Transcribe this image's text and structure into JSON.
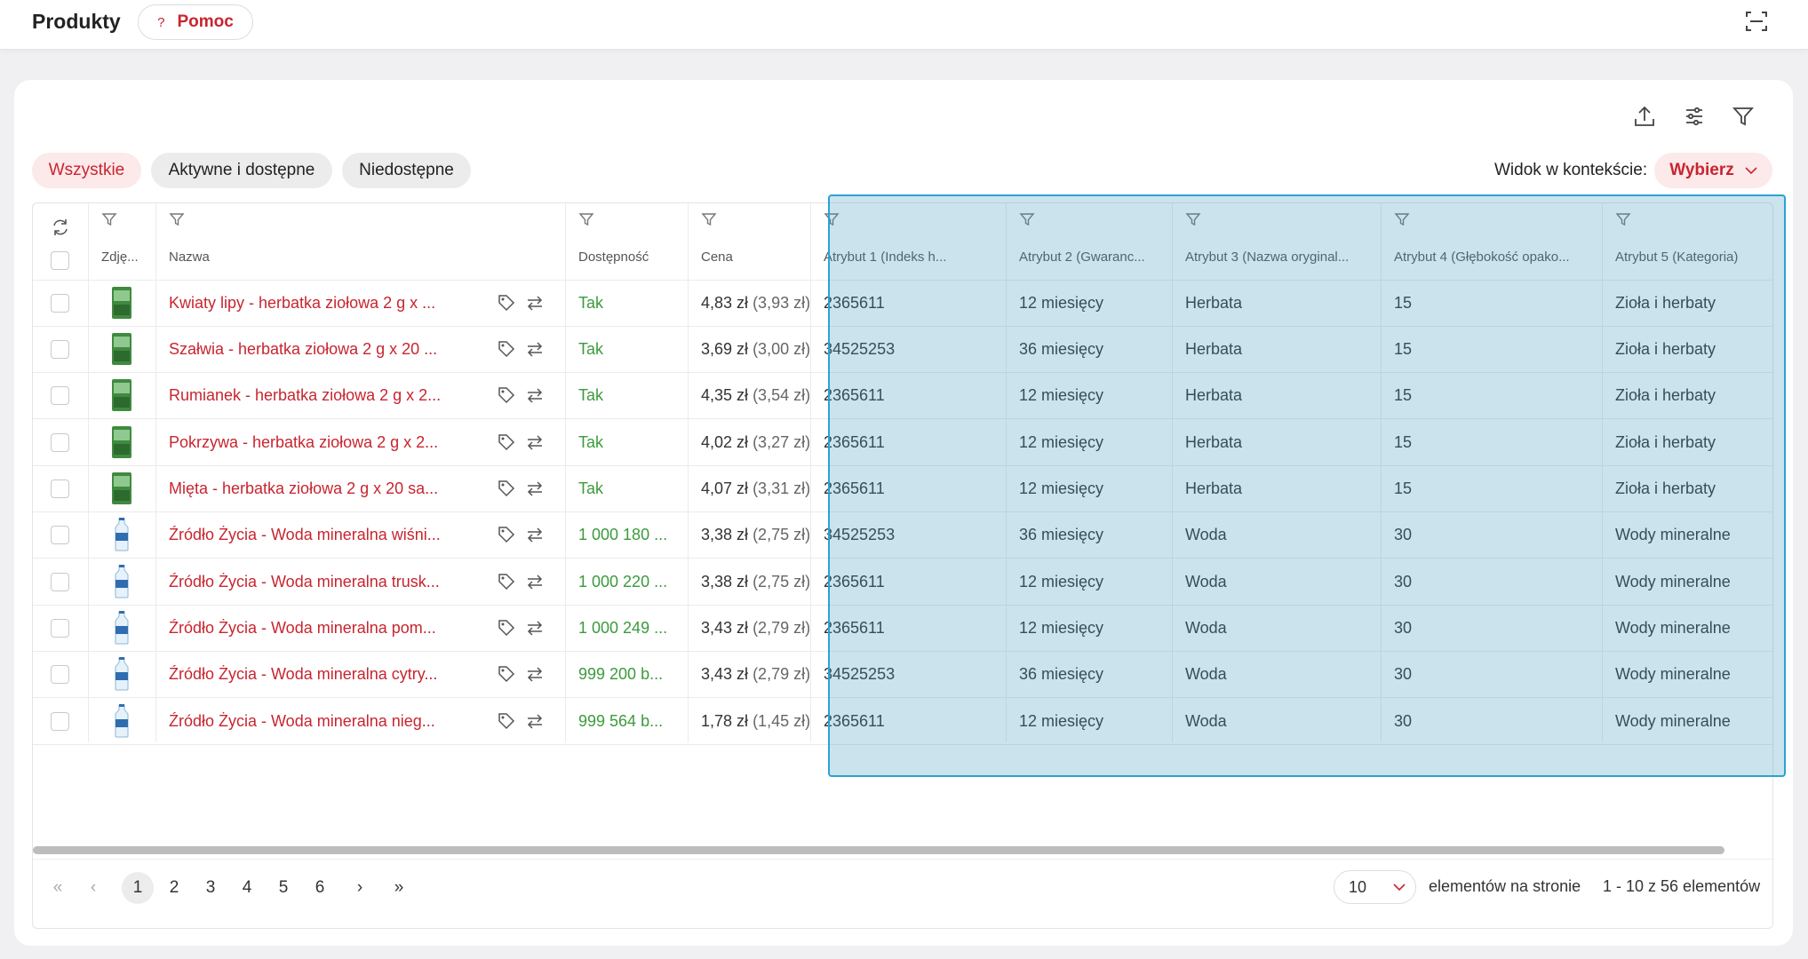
{
  "header": {
    "title": "Produkty",
    "help_label": "Pomoc",
    "help_icon": "?"
  },
  "toolbar": {
    "icons": [
      "export-icon",
      "settings-sliders-icon",
      "filter-icon"
    ]
  },
  "tabs": [
    {
      "label": "Wszystkie",
      "active": true
    },
    {
      "label": "Aktywne i dostępne",
      "active": false
    },
    {
      "label": "Niedostępne",
      "active": false
    }
  ],
  "context_view": {
    "label": "Widok w kontekście:",
    "select_label": "Wybierz"
  },
  "table": {
    "columns": [
      "Zdję...",
      "Nazwa",
      "Dostępność",
      "Cena",
      "Atrybut 1 (Indeks h...",
      "Atrybut 2 (Gwaranc...",
      "Atrybut 3 (Nazwa oryginal...",
      "Atrybut 4 (Głębokość opako...",
      "Atrybut 5 (Kategoria)"
    ],
    "rows": [
      {
        "img": "tea-box",
        "name": "Kwiaty lipy - herbatka ziołowa 2 g x ...",
        "avail": "Tak",
        "price": "4,83 zł",
        "net": "(3,93 zł)",
        "a1": "2365611",
        "a2": "12 miesięcy",
        "a3": "Herbata",
        "a4": "15",
        "a5": "Zioła i herbaty"
      },
      {
        "img": "tea-box",
        "name": "Szałwia - herbatka ziołowa 2 g x 20 ...",
        "avail": "Tak",
        "price": "3,69 zł",
        "net": "(3,00 zł)",
        "a1": "34525253",
        "a2": "36 miesięcy",
        "a3": "Herbata",
        "a4": "15",
        "a5": "Zioła i herbaty"
      },
      {
        "img": "tea-box",
        "name": "Rumianek - herbatka ziołowa 2 g x 2...",
        "avail": "Tak",
        "price": "4,35 zł",
        "net": "(3,54 zł)",
        "a1": "2365611",
        "a2": "12 miesięcy",
        "a3": "Herbata",
        "a4": "15",
        "a5": "Zioła i herbaty"
      },
      {
        "img": "tea-box",
        "name": "Pokrzywa - herbatka ziołowa 2 g x 2...",
        "avail": "Tak",
        "price": "4,02 zł",
        "net": "(3,27 zł)",
        "a1": "2365611",
        "a2": "12 miesięcy",
        "a3": "Herbata",
        "a4": "15",
        "a5": "Zioła i herbaty"
      },
      {
        "img": "tea-box",
        "name": "Mięta - herbatka ziołowa 2 g x 20 sa...",
        "avail": "Tak",
        "price": "4,07 zł",
        "net": "(3,31 zł)",
        "a1": "2365611",
        "a2": "12 miesięcy",
        "a3": "Herbata",
        "a4": "15",
        "a5": "Zioła i herbaty"
      },
      {
        "img": "water-bottle",
        "name": "Źródło Życia - Woda mineralna wiśni...",
        "avail": "1 000 180 ...",
        "price": "3,38 zł",
        "net": "(2,75 zł)",
        "a1": "34525253",
        "a2": "36 miesięcy",
        "a3": "Woda",
        "a4": "30",
        "a5": "Wody mineralne"
      },
      {
        "img": "water-bottle",
        "name": "Źródło Życia - Woda mineralna trusk...",
        "avail": "1 000 220 ...",
        "price": "3,38 zł",
        "net": "(2,75 zł)",
        "a1": "2365611",
        "a2": "12 miesięcy",
        "a3": "Woda",
        "a4": "30",
        "a5": "Wody mineralne"
      },
      {
        "img": "water-bottle",
        "name": "Źródło Życia - Woda mineralna pom...",
        "avail": "1 000 249 ...",
        "price": "3,43 zł",
        "net": "(2,79 zł)",
        "a1": "2365611",
        "a2": "12 miesięcy",
        "a3": "Woda",
        "a4": "30",
        "a5": "Wody mineralne"
      },
      {
        "img": "water-bottle",
        "name": "Źródło Życia - Woda mineralna cytry...",
        "avail": "999 200 b...",
        "price": "3,43 zł",
        "net": "(2,79 zł)",
        "a1": "34525253",
        "a2": "36 miesięcy",
        "a3": "Woda",
        "a4": "30",
        "a5": "Wody mineralne"
      },
      {
        "img": "water-bottle",
        "name": "Źródło Życia - Woda mineralna nieg...",
        "avail": "999 564 b...",
        "price": "1,78 zł",
        "net": "(1,45 zł)",
        "a1": "2365611",
        "a2": "12 miesięcy",
        "a3": "Woda",
        "a4": "30",
        "a5": "Wody mineralne"
      }
    ]
  },
  "pagination": {
    "pages": [
      "1",
      "2",
      "3",
      "4",
      "5",
      "6"
    ],
    "current": "1",
    "page_size": "10",
    "per_page_label": "elementów na stronie",
    "range_label": "1 - 10 z 56 elementów"
  },
  "colors": {
    "accent": "#c8252f",
    "available": "#3c9a3c",
    "highlight": "#2aa3d6"
  }
}
